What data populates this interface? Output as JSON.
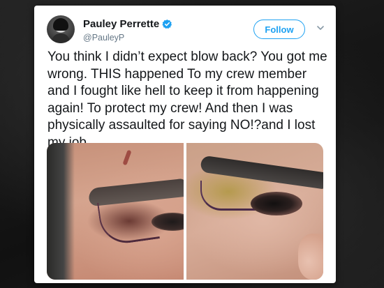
{
  "tweet": {
    "display_name": "Pauley Perrette",
    "handle": "@PauleyP",
    "verified_icon": "verified-badge-icon",
    "follow_label": "Follow",
    "text": "You think I didn’t expect blow back? You got me wrong. THIS happened To my crew member and I fought like hell to keep it from happening again! To protect my crew! And then I was physically assaulted for saying NO!?and I lost my job.",
    "media": [
      {
        "kind": "photo",
        "subject": "eye-wound-closeup-left"
      },
      {
        "kind": "photo",
        "subject": "eye-wound-closeup-right"
      }
    ]
  },
  "colors": {
    "accent": "#1da1f2",
    "text": "#14171a",
    "muted": "#657786",
    "background": "#1a1a1a"
  }
}
